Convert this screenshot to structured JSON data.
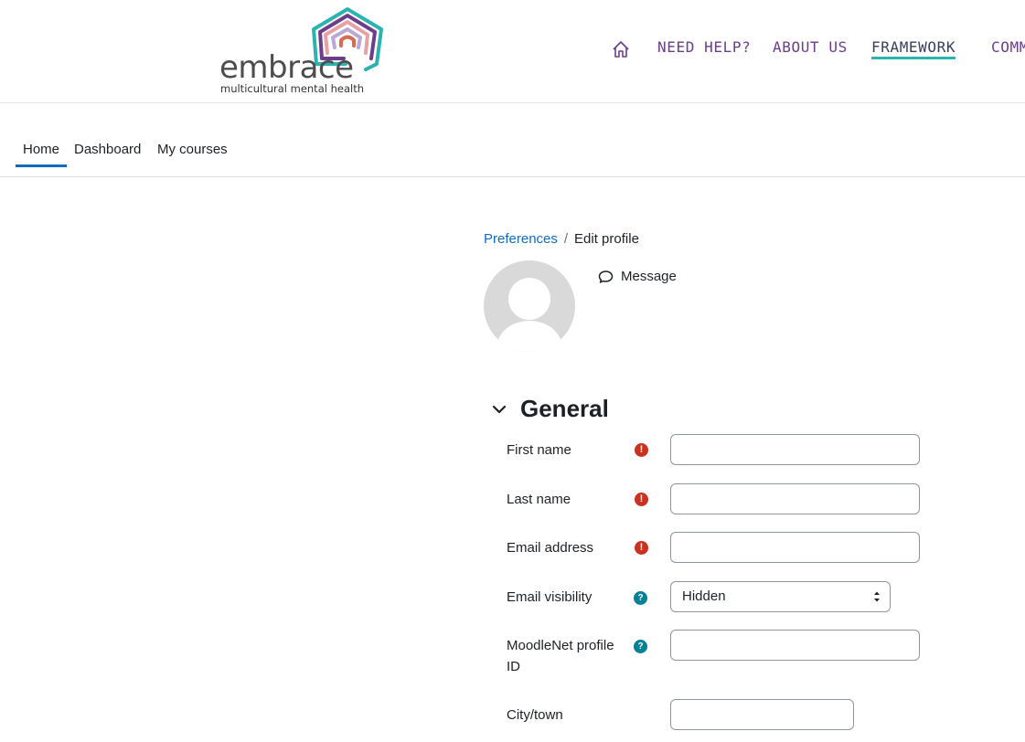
{
  "brand": {
    "wordmark": "embrace",
    "tagline": "multicultural mental health",
    "colors": {
      "teal": "#2bb3b1",
      "purple": "#6b3d8a",
      "pink": "#e6a0a6",
      "coral": "#d86b50"
    }
  },
  "main_nav": {
    "home_icon": "house-icon",
    "items": [
      "NEED HELP?",
      "ABOUT US",
      "FRAMEWORK",
      "COMM"
    ],
    "active": "FRAMEWORK"
  },
  "sub_nav": {
    "tabs": [
      "Home",
      "Dashboard",
      "My courses"
    ],
    "active": "Home"
  },
  "breadcrumb": {
    "parent": "Preferences",
    "separator": "/",
    "current": "Edit profile"
  },
  "profile": {
    "message_label": "Message",
    "message_icon": "chat-bubble-icon"
  },
  "form": {
    "section_title": "General",
    "fields": {
      "first_name": {
        "label": "First name",
        "value": "",
        "required": true
      },
      "last_name": {
        "label": "Last name",
        "value": "",
        "required": true
      },
      "email": {
        "label": "Email address",
        "value": "",
        "required": true
      },
      "email_visibility": {
        "label": "Email visibility",
        "value": "Hidden",
        "help": true
      },
      "moodlenet": {
        "label": "MoodleNet profile ID",
        "value": "",
        "help": true
      },
      "city": {
        "label": "City/town",
        "value": ""
      }
    },
    "required_mark": "!",
    "help_mark": "?"
  }
}
